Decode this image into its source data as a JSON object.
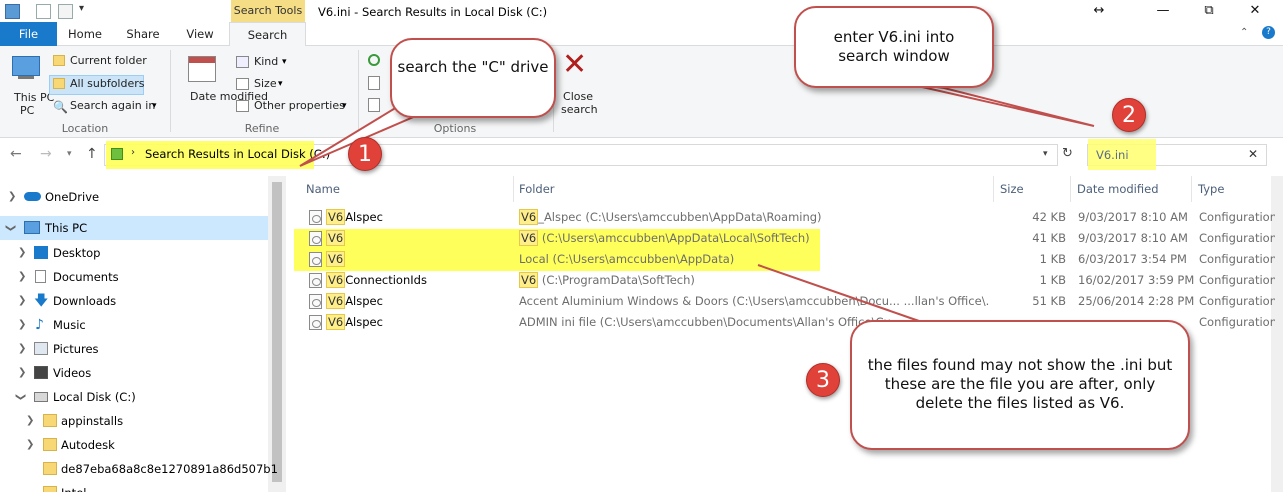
{
  "window": {
    "title": "V6.ini - Search Results in Local Disk (C:)",
    "context_tab": "Search Tools",
    "controls": [
      "↔",
      "—",
      "⧉",
      "✕"
    ]
  },
  "tabs": [
    {
      "label": "File"
    },
    {
      "label": "Home"
    },
    {
      "label": "Share"
    },
    {
      "label": "View"
    },
    {
      "label": "Search"
    }
  ],
  "ribbon": {
    "this_pc": "This PC",
    "current_folder": "Current folder",
    "all_subfolders": "All subfolders",
    "search_again_in": "Search again in",
    "location_group": "Location",
    "date_modified": "Date modified",
    "kind": "Kind",
    "size": "Size",
    "other_properties": "Other properties",
    "refine_group": "Refine",
    "options_group": "Options",
    "close_search": "Close search"
  },
  "address": {
    "path": "Search Results in Local Disk (C:)",
    "search_value": "V6.ini"
  },
  "nav_tree": [
    {
      "label": "OneDrive"
    },
    {
      "label": "This PC"
    },
    {
      "label": "Desktop"
    },
    {
      "label": "Documents"
    },
    {
      "label": "Downloads"
    },
    {
      "label": "Music"
    },
    {
      "label": "Pictures"
    },
    {
      "label": "Videos"
    },
    {
      "label": "Local Disk (C:)"
    },
    {
      "label": "appinstalls"
    },
    {
      "label": "Autodesk"
    },
    {
      "label": "de87eba68a8c8e1270891a86d507b1"
    },
    {
      "label": "Intel"
    }
  ],
  "columns": {
    "name": "Name",
    "folder": "Folder",
    "size": "Size",
    "date": "Date modified",
    "type": "Type"
  },
  "files": [
    {
      "name_hl": "V6",
      "name_rest": "Alspec",
      "folder_hl": "V6",
      "folder_rest": "_Alspec (C:\\Users\\amccubben\\AppData\\Roaming)",
      "size": "42 KB",
      "date": "9/03/2017 8:10 AM",
      "type": "Configuration s"
    },
    {
      "name_hl": "V6",
      "name_rest": "",
      "folder_hl": "V6",
      "folder_rest": " (C:\\Users\\amccubben\\AppData\\Local\\SoftTech)",
      "size": "41 KB",
      "date": "9/03/2017 8:10 AM",
      "type": "Configuration s"
    },
    {
      "name_hl": "V6",
      "name_rest": "",
      "folder_hl": "",
      "folder_rest": "Local (C:\\Users\\amccubben\\AppData)",
      "size": "1 KB",
      "date": "6/03/2017 3:54 PM",
      "type": "Configuration s"
    },
    {
      "name_hl": "V6",
      "name_rest": "ConnectionIds",
      "folder_hl": "V6",
      "folder_rest": " (C:\\ProgramData\\SoftTech)",
      "size": "1 KB",
      "date": "16/02/2017 3:59 PM",
      "type": "Configuration s"
    },
    {
      "name_hl": "V6",
      "name_rest": "Alspec",
      "folder_hl": "",
      "folder_rest": "Accent Aluminium Windows & Doors (C:\\Users\\amccubben\\Docu... ...llan's Office\\...",
      "size": "51 KB",
      "date": "25/06/2014 2:28 PM",
      "type": "Configuration s"
    },
    {
      "name_hl": "V6",
      "name_rest": "Alspec",
      "folder_hl": "",
      "folder_rest": "ADMIN ini file (C:\\Users\\amccubben\\Documents\\Allan's Office\\Cu...",
      "size": "",
      "date": "",
      "type": "Configuration s"
    }
  ],
  "callouts": {
    "c1": {
      "number": "1",
      "text": "search the \"C\" drive"
    },
    "c2": {
      "number": "2",
      "text": "enter V6.ini into search window"
    },
    "c3": {
      "number": "3",
      "text": "the files found may not show the .ini but these are the file you are after, only delete the files listed as V6."
    }
  },
  "colors": {
    "file_tab": "#1979ca",
    "highlight": "#ffff4a",
    "callout_border": "#c0504d",
    "badge": "#e0423a",
    "selected_nav": "#cce8ff"
  }
}
